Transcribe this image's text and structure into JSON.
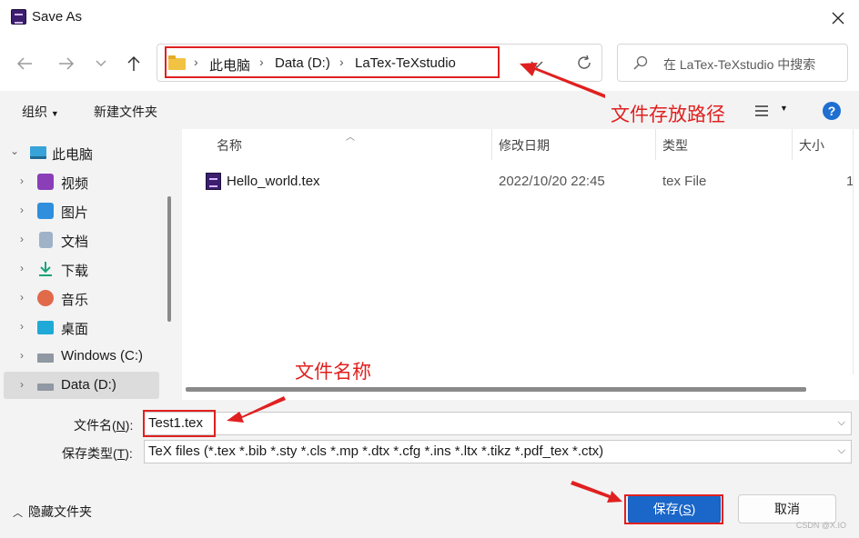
{
  "window": {
    "title": "Save As",
    "close_icon": "close-icon",
    "app_icon": "texstudio-app-icon"
  },
  "nav": {
    "back_icon": "arrow-left-icon",
    "forward_icon": "arrow-right-icon",
    "recent_icon": "chevron-down-icon",
    "up_icon": "arrow-up-icon",
    "breadcrumb": [
      "此电脑",
      "Data (D:)",
      "LaTex-TeXstudio"
    ],
    "refresh_icon": "refresh-icon",
    "search_placeholder": "在 LaTex-TeXstudio 中搜索"
  },
  "toolbar": {
    "organize": "组织",
    "new_folder": "新建文件夹",
    "view_icon": "list-view-icon",
    "help_icon": "help-icon",
    "help_glyph": "?"
  },
  "annotations": {
    "path": "文件存放路径",
    "name": "文件名称",
    "color": "#e02020"
  },
  "sidebar": {
    "items": [
      {
        "label": "此电脑",
        "icon": "computer-icon"
      },
      {
        "label": "视频",
        "icon": "video-icon"
      },
      {
        "label": "图片",
        "icon": "pictures-icon"
      },
      {
        "label": "文档",
        "icon": "documents-icon"
      },
      {
        "label": "下载",
        "icon": "download-icon"
      },
      {
        "label": "音乐",
        "icon": "music-icon"
      },
      {
        "label": "桌面",
        "icon": "desktop-icon"
      },
      {
        "label": "Windows (C:)",
        "icon": "drive-c-icon"
      },
      {
        "label": "Data (D:)",
        "icon": "drive-d-icon"
      }
    ]
  },
  "files": {
    "columns": [
      "名称",
      "修改日期",
      "类型",
      "大小"
    ],
    "rows": [
      {
        "name": "Hello_world.tex",
        "modified": "2022/10/20 22:45",
        "type": "tex File",
        "size": "1"
      }
    ]
  },
  "form": {
    "filename_label": "文件名(",
    "filename_hotkey": "N",
    "filename_label_end": "):",
    "filename_value": "Test1.tex",
    "filetype_label": "保存类型(",
    "filetype_hotkey": "T",
    "filetype_label_end": "):",
    "filetype_value": "TeX files (*.tex *.bib *.sty *.cls *.mp *.dtx *.cfg *.ins *.ltx *.tikz *.pdf_tex *.ctx)"
  },
  "footer": {
    "hide_folders": "隐藏文件夹",
    "save_label": "保存(",
    "save_hotkey": "S",
    "save_label_end": ")",
    "cancel_label": "取消",
    "watermark": "CSDN @X.IO"
  },
  "colors": {
    "accent": "#1a66c9",
    "annotation": "#e02020"
  }
}
